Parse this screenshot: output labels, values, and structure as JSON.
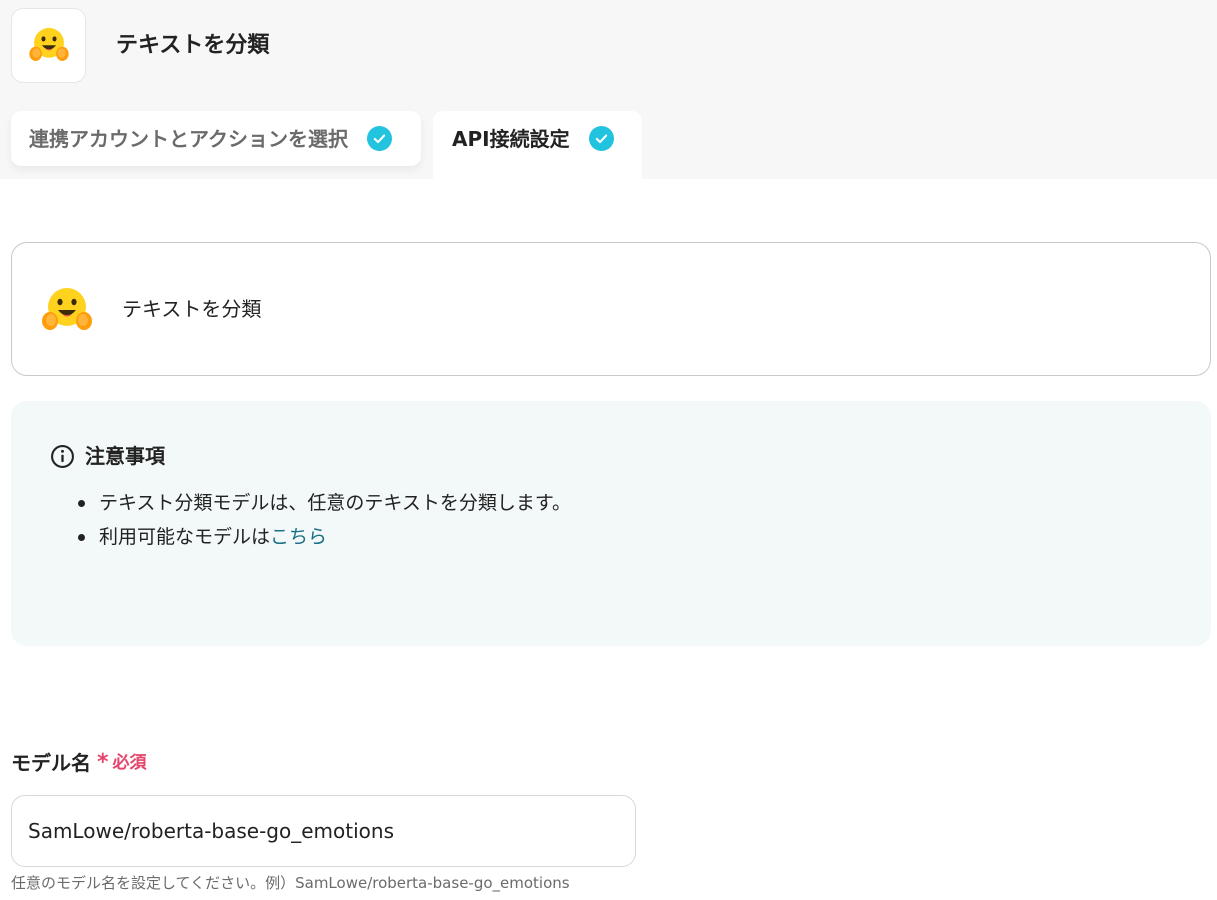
{
  "header": {
    "title": "テキストを分類",
    "app_icon": "hugging-face-emoji-icon"
  },
  "tabs": [
    {
      "label": "連携アカウントとアクションを選択",
      "completed": true,
      "active": false
    },
    {
      "label": "API接続設定",
      "completed": true,
      "active": true
    }
  ],
  "action_card": {
    "title": "テキストを分類",
    "icon": "hugging-face-emoji-icon"
  },
  "notice": {
    "icon": "info-icon",
    "title": "注意事項",
    "items": [
      {
        "text": "テキスト分類モデルは、任意のテキストを分類します。"
      },
      {
        "text": "利用可能なモデルは",
        "link": "こちら"
      }
    ]
  },
  "model_field": {
    "label": "モデル名",
    "required_mark": "*",
    "required_text": "必須",
    "value": "SamLowe/roberta-base-go_emotions",
    "help": "任意のモデル名を設定してください。例）SamLowe/roberta-base-go_emotions"
  },
  "colors": {
    "check_badge": "#22c3de",
    "required": "#e5446b",
    "link": "#1b6f86",
    "notice_bg": "#f2f9f8",
    "header_bg": "#f7f7f7"
  }
}
